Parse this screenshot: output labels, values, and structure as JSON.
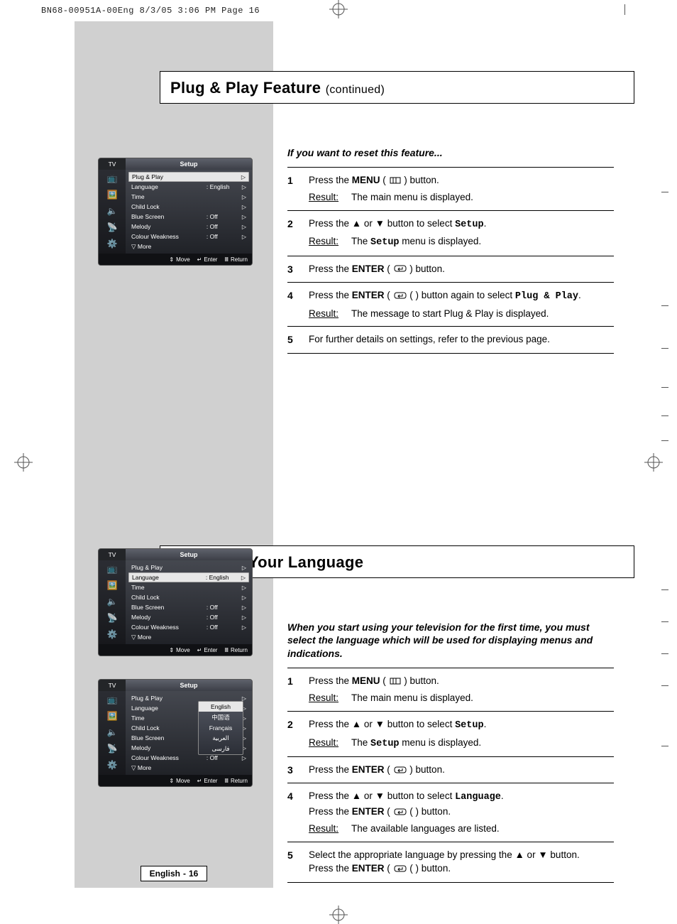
{
  "slug": "BN68-00951A-00Eng  8/3/05  3:06 PM  Page 16",
  "section1": {
    "title": "Plug & Play Feature",
    "continued": "(continued)",
    "intro": "If you want to reset this feature...",
    "steps": [
      {
        "num": "1",
        "text_before": "Press the ",
        "bold1": "MENU",
        "text_after": " (      ) button.",
        "result_label": "Result:",
        "result_text": "The main menu is displayed."
      },
      {
        "num": "2",
        "text_before": "Press the ▲ or ▼ button to select ",
        "mono1": "Setup",
        "text_after": ".",
        "result_label": "Result:",
        "result_text_before": "The ",
        "result_mono": "Setup",
        "result_text_after": " menu is displayed."
      },
      {
        "num": "3",
        "text_before": "Press the ",
        "bold1": "ENTER",
        "text_after": " (      ) button."
      },
      {
        "num": "4",
        "text_before": "Press the ",
        "bold1": "ENTER",
        "text_mid": " (      ) button again to select ",
        "mono1": "Plug & Play",
        "text_after": ".",
        "result_label": "Result:",
        "result_text": "The message to start Plug & Play is displayed."
      },
      {
        "num": "5",
        "text": "For further details on settings, refer to the previous page."
      }
    ]
  },
  "section2": {
    "title": "Choosing Your Language",
    "intro": "When you start using your television for the first time, you must select the language which will be used for displaying menus and indications.",
    "steps": [
      {
        "num": "1",
        "text_before": "Press the ",
        "bold1": "MENU",
        "text_after": " (      ) button.",
        "result_label": "Result:",
        "result_text": "The main menu is displayed."
      },
      {
        "num": "2",
        "text_before": "Press the ▲ or ▼ button to select ",
        "mono1": "Setup",
        "text_after": ".",
        "result_label": "Result:",
        "result_text_before": "The ",
        "result_mono": "Setup",
        "result_text_after": " menu is displayed."
      },
      {
        "num": "3",
        "text_before": "Press the ",
        "bold1": "ENTER",
        "text_after": " (      ) button."
      },
      {
        "num": "4",
        "line1_before": "Press the ▲ or ▼ button to select ",
        "mono1": "Language",
        "line1_after": ".",
        "line2_before": "Press the ",
        "bold2": "ENTER",
        "line2_after": " (      ) button.",
        "result_label": "Result:",
        "result_text": "The available languages are listed."
      },
      {
        "num": "5",
        "line1": "Select the appropriate language by pressing the ▲ or ▼ button.",
        "line2_before": "Press the ",
        "bold2": "ENTER",
        "line2_after": " (      ) button."
      }
    ]
  },
  "osd": {
    "tv": "TV",
    "title": "Setup",
    "rows": [
      {
        "label": "Plug & Play",
        "value": ""
      },
      {
        "label": "Language",
        "value": ": English"
      },
      {
        "label": "Time",
        "value": ""
      },
      {
        "label": "Child Lock",
        "value": ""
      },
      {
        "label": "Blue Screen",
        "value": ": Off"
      },
      {
        "label": "Melody",
        "value": ": Off"
      },
      {
        "label": "Colour Weakness",
        "value": ": Off"
      },
      {
        "label": "▽ More",
        "value": "",
        "noarrow": true
      }
    ],
    "popup": [
      "English",
      "中国语",
      "Français",
      "العربية",
      "فارسی"
    ],
    "footer": {
      "move": "Move",
      "enter": "Enter",
      "return": "Return"
    }
  },
  "footer": {
    "lang": "English",
    "sep": " - ",
    "page": "16"
  }
}
